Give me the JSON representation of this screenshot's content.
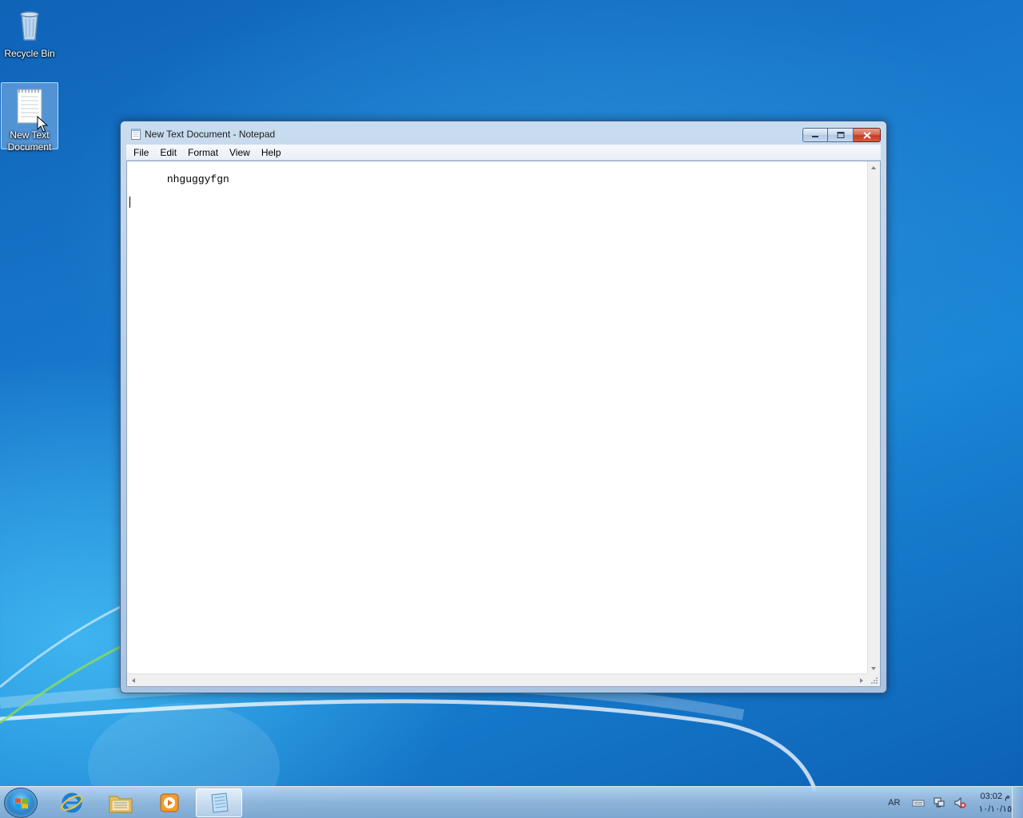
{
  "desktop": {
    "icons": [
      {
        "label": "Recycle Bin",
        "icon": "recycle-bin-icon"
      },
      {
        "label_line1": "New Text",
        "label_line2": "Document",
        "icon": "text-document-icon",
        "selected": true
      }
    ]
  },
  "window": {
    "title": "New Text Document - Notepad",
    "app_icon": "notepad-icon",
    "controls": {
      "minimize": "minimize",
      "maximize": "maximize",
      "close": "close"
    },
    "menu": [
      "File",
      "Edit",
      "Format",
      "View",
      "Help"
    ],
    "content": "nhguggyfgn"
  },
  "taskbar": {
    "apps": [
      {
        "name": "internet-explorer-icon"
      },
      {
        "name": "windows-explorer-icon"
      },
      {
        "name": "media-player-icon"
      },
      {
        "name": "notepad-icon",
        "active": true
      }
    ],
    "tray": {
      "language": "AR",
      "time": "03:02 م",
      "date": "١٠/١٠/١٥"
    }
  },
  "colors": {
    "desktop_bg": "#1878cc",
    "close_button": "#c43b22",
    "window_frame": "#b9d0ea"
  }
}
